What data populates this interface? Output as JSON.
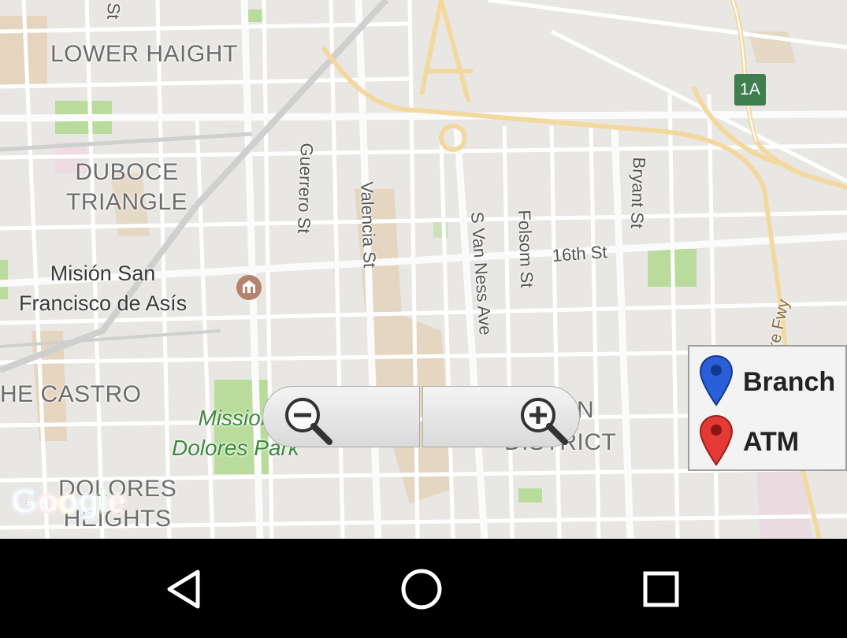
{
  "map": {
    "neighborhoods": [
      {
        "name": "LOWER HAIGHT"
      },
      {
        "name": "DUBOCE\nTRIANGLE"
      },
      {
        "name": "HE CASTRO"
      },
      {
        "name": "DOLORES\nHEIGHTS"
      },
      {
        "name": "N"
      },
      {
        "name": "DISTRICT"
      }
    ],
    "streets": [
      {
        "name": "Guerrero St"
      },
      {
        "name": "Valencia St"
      },
      {
        "name": "S Van Ness Ave"
      },
      {
        "name": "Folsom St"
      },
      {
        "name": "Bryant St"
      },
      {
        "name": "16th St"
      },
      {
        "name": "St"
      }
    ],
    "highway": {
      "name": "Bayshore Fwy",
      "shield": "1A"
    },
    "poi": {
      "name": "Misión San\nFrancisco de Asís",
      "icon": "mission-landmark-icon"
    },
    "park": {
      "name": "Mission\nDolores Park"
    },
    "attribution": {
      "text": "Google"
    },
    "colors": {
      "land": "#e9e7e4",
      "road": "#ffffff",
      "arterial": "#f3d9a0",
      "park": "#b9dc9c",
      "district": "#e2c9a6"
    }
  },
  "zoom_controls": {
    "zoom_out_icon": "zoom-out-magnifier-icon",
    "zoom_in_icon": "zoom-in-magnifier-icon"
  },
  "legend": {
    "items": [
      {
        "label": "Branch",
        "icon": "blue-map-pin-icon",
        "color": "#2b5fd9"
      },
      {
        "label": "ATM",
        "icon": "red-map-pin-icon",
        "color": "#e53935"
      }
    ]
  },
  "navbar": {
    "back_icon": "back-triangle-icon",
    "home_icon": "home-circle-icon",
    "recents_icon": "recents-square-icon"
  }
}
